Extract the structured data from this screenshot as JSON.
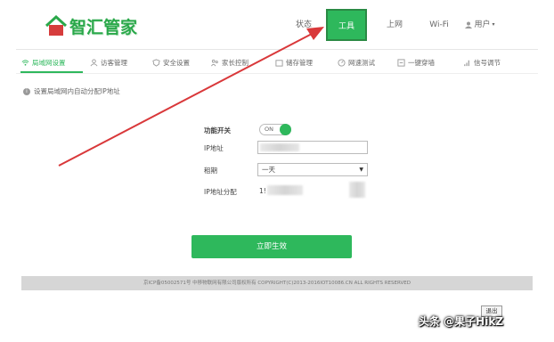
{
  "header": {
    "logo_text": "智汇管家",
    "nav": [
      {
        "label": "状态"
      },
      {
        "label": "工具"
      },
      {
        "label": "上网"
      },
      {
        "label": "Wi-Fi"
      },
      {
        "label": "用户"
      }
    ],
    "active_nav_color": "#2eb85c"
  },
  "subtabs": [
    {
      "label": "局域网设置",
      "icon": "wifi-icon"
    },
    {
      "label": "访客管理",
      "icon": "user-icon"
    },
    {
      "label": "安全设置",
      "icon": "shield-icon"
    },
    {
      "label": "家长控制",
      "icon": "people-icon"
    },
    {
      "label": "储存管理",
      "icon": "folder-icon"
    },
    {
      "label": "网速测试",
      "icon": "speed-icon"
    },
    {
      "label": "一键穿墙",
      "icon": "wall-icon"
    },
    {
      "label": "信号调节",
      "icon": "signal-icon"
    }
  ],
  "description": "设置局域网内自动分配IP地址",
  "form": {
    "switch_label": "功能开关",
    "switch_value": "ON",
    "ip_label": "IP地址",
    "lease_label": "租期",
    "lease_value": "一天",
    "range_label": "IP地址分配",
    "range_prefix": "1!"
  },
  "apply_button": "立即生效",
  "footer": "京ICP备05002571号 中移物联网有限公司版权所有 COPYRIGHT(C)2013-2016IOT10086.CN ALL RIGHTS RESERVED",
  "logout_button": "退出",
  "watermark": "头条 @果子HikZ",
  "colors": {
    "accent": "#2eb85c",
    "arrow": "#d9383a"
  }
}
